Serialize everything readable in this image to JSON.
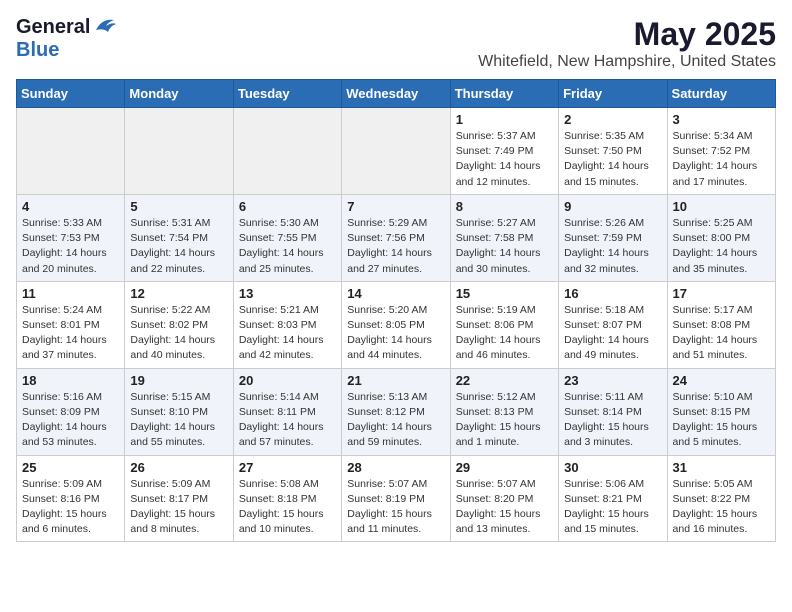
{
  "header": {
    "logo_general": "General",
    "logo_blue": "Blue",
    "title": "May 2025",
    "subtitle": "Whitefield, New Hampshire, United States"
  },
  "days_of_week": [
    "Sunday",
    "Monday",
    "Tuesday",
    "Wednesday",
    "Thursday",
    "Friday",
    "Saturday"
  ],
  "weeks": [
    [
      {
        "day": "",
        "info": ""
      },
      {
        "day": "",
        "info": ""
      },
      {
        "day": "",
        "info": ""
      },
      {
        "day": "",
        "info": ""
      },
      {
        "day": "1",
        "info": "Sunrise: 5:37 AM\nSunset: 7:49 PM\nDaylight: 14 hours\nand 12 minutes."
      },
      {
        "day": "2",
        "info": "Sunrise: 5:35 AM\nSunset: 7:50 PM\nDaylight: 14 hours\nand 15 minutes."
      },
      {
        "day": "3",
        "info": "Sunrise: 5:34 AM\nSunset: 7:52 PM\nDaylight: 14 hours\nand 17 minutes."
      }
    ],
    [
      {
        "day": "4",
        "info": "Sunrise: 5:33 AM\nSunset: 7:53 PM\nDaylight: 14 hours\nand 20 minutes."
      },
      {
        "day": "5",
        "info": "Sunrise: 5:31 AM\nSunset: 7:54 PM\nDaylight: 14 hours\nand 22 minutes."
      },
      {
        "day": "6",
        "info": "Sunrise: 5:30 AM\nSunset: 7:55 PM\nDaylight: 14 hours\nand 25 minutes."
      },
      {
        "day": "7",
        "info": "Sunrise: 5:29 AM\nSunset: 7:56 PM\nDaylight: 14 hours\nand 27 minutes."
      },
      {
        "day": "8",
        "info": "Sunrise: 5:27 AM\nSunset: 7:58 PM\nDaylight: 14 hours\nand 30 minutes."
      },
      {
        "day": "9",
        "info": "Sunrise: 5:26 AM\nSunset: 7:59 PM\nDaylight: 14 hours\nand 32 minutes."
      },
      {
        "day": "10",
        "info": "Sunrise: 5:25 AM\nSunset: 8:00 PM\nDaylight: 14 hours\nand 35 minutes."
      }
    ],
    [
      {
        "day": "11",
        "info": "Sunrise: 5:24 AM\nSunset: 8:01 PM\nDaylight: 14 hours\nand 37 minutes."
      },
      {
        "day": "12",
        "info": "Sunrise: 5:22 AM\nSunset: 8:02 PM\nDaylight: 14 hours\nand 40 minutes."
      },
      {
        "day": "13",
        "info": "Sunrise: 5:21 AM\nSunset: 8:03 PM\nDaylight: 14 hours\nand 42 minutes."
      },
      {
        "day": "14",
        "info": "Sunrise: 5:20 AM\nSunset: 8:05 PM\nDaylight: 14 hours\nand 44 minutes."
      },
      {
        "day": "15",
        "info": "Sunrise: 5:19 AM\nSunset: 8:06 PM\nDaylight: 14 hours\nand 46 minutes."
      },
      {
        "day": "16",
        "info": "Sunrise: 5:18 AM\nSunset: 8:07 PM\nDaylight: 14 hours\nand 49 minutes."
      },
      {
        "day": "17",
        "info": "Sunrise: 5:17 AM\nSunset: 8:08 PM\nDaylight: 14 hours\nand 51 minutes."
      }
    ],
    [
      {
        "day": "18",
        "info": "Sunrise: 5:16 AM\nSunset: 8:09 PM\nDaylight: 14 hours\nand 53 minutes."
      },
      {
        "day": "19",
        "info": "Sunrise: 5:15 AM\nSunset: 8:10 PM\nDaylight: 14 hours\nand 55 minutes."
      },
      {
        "day": "20",
        "info": "Sunrise: 5:14 AM\nSunset: 8:11 PM\nDaylight: 14 hours\nand 57 minutes."
      },
      {
        "day": "21",
        "info": "Sunrise: 5:13 AM\nSunset: 8:12 PM\nDaylight: 14 hours\nand 59 minutes."
      },
      {
        "day": "22",
        "info": "Sunrise: 5:12 AM\nSunset: 8:13 PM\nDaylight: 15 hours\nand 1 minute."
      },
      {
        "day": "23",
        "info": "Sunrise: 5:11 AM\nSunset: 8:14 PM\nDaylight: 15 hours\nand 3 minutes."
      },
      {
        "day": "24",
        "info": "Sunrise: 5:10 AM\nSunset: 8:15 PM\nDaylight: 15 hours\nand 5 minutes."
      }
    ],
    [
      {
        "day": "25",
        "info": "Sunrise: 5:09 AM\nSunset: 8:16 PM\nDaylight: 15 hours\nand 6 minutes."
      },
      {
        "day": "26",
        "info": "Sunrise: 5:09 AM\nSunset: 8:17 PM\nDaylight: 15 hours\nand 8 minutes."
      },
      {
        "day": "27",
        "info": "Sunrise: 5:08 AM\nSunset: 8:18 PM\nDaylight: 15 hours\nand 10 minutes."
      },
      {
        "day": "28",
        "info": "Sunrise: 5:07 AM\nSunset: 8:19 PM\nDaylight: 15 hours\nand 11 minutes."
      },
      {
        "day": "29",
        "info": "Sunrise: 5:07 AM\nSunset: 8:20 PM\nDaylight: 15 hours\nand 13 minutes."
      },
      {
        "day": "30",
        "info": "Sunrise: 5:06 AM\nSunset: 8:21 PM\nDaylight: 15 hours\nand 15 minutes."
      },
      {
        "day": "31",
        "info": "Sunrise: 5:05 AM\nSunset: 8:22 PM\nDaylight: 15 hours\nand 16 minutes."
      }
    ]
  ]
}
